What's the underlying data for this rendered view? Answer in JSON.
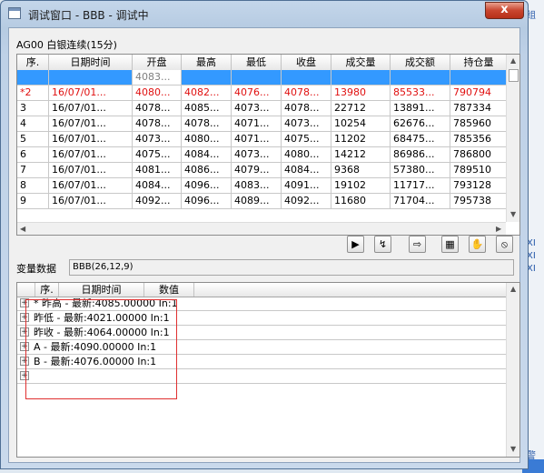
{
  "window": {
    "title": "调试窗口 - BBB - 调试中",
    "close_glyph": "x"
  },
  "symbol": {
    "label": "AG00 白银连续(15分)"
  },
  "quotes": {
    "headers": [
      "序.",
      "日期时间",
      "开盘",
      "最高",
      "最低",
      "收盘",
      "成交量",
      "成交额",
      "持仓量"
    ],
    "rows": [
      {
        "no": "",
        "datetime": "",
        "open": "4083...",
        "high": "",
        "low": "",
        "close": "",
        "volume": "",
        "amount": "",
        "oi": "",
        "style": "selected"
      },
      {
        "no": "*2",
        "datetime": "16/07/01...",
        "open": "4080...",
        "high": "4082...",
        "low": "4076...",
        "close": "4078...",
        "volume": "13980",
        "amount": "85533...",
        "oi": "790794",
        "style": "red"
      },
      {
        "no": "3",
        "datetime": "16/07/01...",
        "open": "4078...",
        "high": "4085...",
        "low": "4073...",
        "close": "4078...",
        "volume": "22712",
        "amount": "13891...",
        "oi": "787334",
        "style": ""
      },
      {
        "no": "4",
        "datetime": "16/07/01...",
        "open": "4078...",
        "high": "4078...",
        "low": "4071...",
        "close": "4073...",
        "volume": "10254",
        "amount": "62676...",
        "oi": "785960",
        "style": ""
      },
      {
        "no": "5",
        "datetime": "16/07/01...",
        "open": "4073...",
        "high": "4080...",
        "low": "4071...",
        "close": "4075...",
        "volume": "11202",
        "amount": "68475...",
        "oi": "785356",
        "style": ""
      },
      {
        "no": "6",
        "datetime": "16/07/01...",
        "open": "4075...",
        "high": "4084...",
        "low": "4073...",
        "close": "4080...",
        "volume": "14212",
        "amount": "86986...",
        "oi": "786800",
        "style": ""
      },
      {
        "no": "7",
        "datetime": "16/07/01...",
        "open": "4081...",
        "high": "4086...",
        "low": "4079...",
        "close": "4084...",
        "volume": "9368",
        "amount": "57380...",
        "oi": "789510",
        "style": ""
      },
      {
        "no": "8",
        "datetime": "16/07/01...",
        "open": "4084...",
        "high": "4096...",
        "low": "4083...",
        "close": "4091...",
        "volume": "19102",
        "amount": "11717...",
        "oi": "793128",
        "style": ""
      },
      {
        "no": "9",
        "datetime": "16/07/01...",
        "open": "4092...",
        "high": "4096...",
        "low": "4089...",
        "close": "4092...",
        "volume": "11680",
        "amount": "71704...",
        "oi": "795738",
        "style": ""
      }
    ]
  },
  "toolbar": {
    "buttons": [
      {
        "name": "step-into-icon",
        "glyph": "▶"
      },
      {
        "name": "step-over-icon",
        "glyph": "↯"
      },
      {
        "name": "step-out-icon",
        "glyph": "⇨"
      },
      {
        "name": "view-chart-icon",
        "glyph": "▦"
      },
      {
        "name": "hand-icon",
        "glyph": "✋"
      },
      {
        "name": "stop-hand-icon",
        "glyph": "⦸"
      }
    ]
  },
  "variables": {
    "label": "变量数据",
    "value": "BBB(26,12,9)",
    "headers": [
      "序.",
      "日期时间",
      "数值"
    ],
    "rows": [
      "* 昨高  -  最新:4085.00000   In:1",
      "昨低  -  最新:4021.00000   In:1",
      "昨收  -  最新:4064.00000   In:1",
      "A  -  最新:4090.00000   In:1",
      "B  -  最新:4076.00000   In:1",
      ""
    ]
  },
  "background": {
    "fragments": [
      "组",
      "XI",
      "XI",
      "XI",
      "警"
    ]
  },
  "colors": {
    "selection": "#3399ff",
    "highlight_text": "#e01010",
    "close_button": "#c9452e",
    "annotation_box": "#e03030"
  }
}
